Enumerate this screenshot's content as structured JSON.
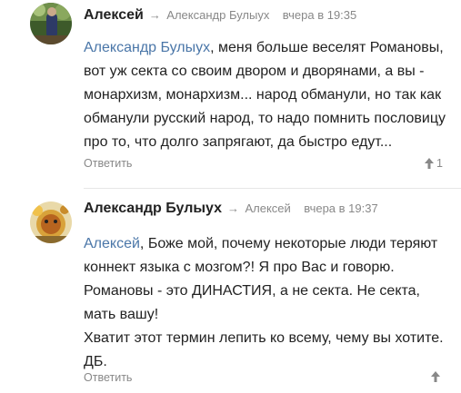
{
  "comments": [
    {
      "author": "Алексей",
      "reply_arrow": "→",
      "reply_to": "Александр Булыух",
      "time": "вчера в 19:35",
      "mention": "Александр Булыух",
      "text": ", меня больше веселят Романовы, вот уж секта со своим двором и дворянами, а вы - монархизм, монархизм... народ обманули, но так как обманули русский народ, то надо помнить пословицу про то, что долго запрягают, да быстро едут...",
      "reply_label": "Ответить",
      "vote_icon": "arrow-up-icon",
      "vote_count": "1"
    },
    {
      "author": "Александр Булыух",
      "reply_arrow": "→",
      "reply_to": "Алексей",
      "time": "вчера в 19:37",
      "mention": "Алексей",
      "text_lines": [
        ", Боже мой, почему некоторые люди теряют коннект языка с мозгом?! Я про Вас и говорю. Романовы - это ДИНАСТИЯ, а не секта. Не секта, мать вашу!",
        "Хватит этот термин лепить ко всему, чему вы хотите.",
        "ДБ."
      ],
      "reply_label": "Ответить",
      "vote_icon": "arrow-up-icon",
      "vote_count": ""
    }
  ]
}
